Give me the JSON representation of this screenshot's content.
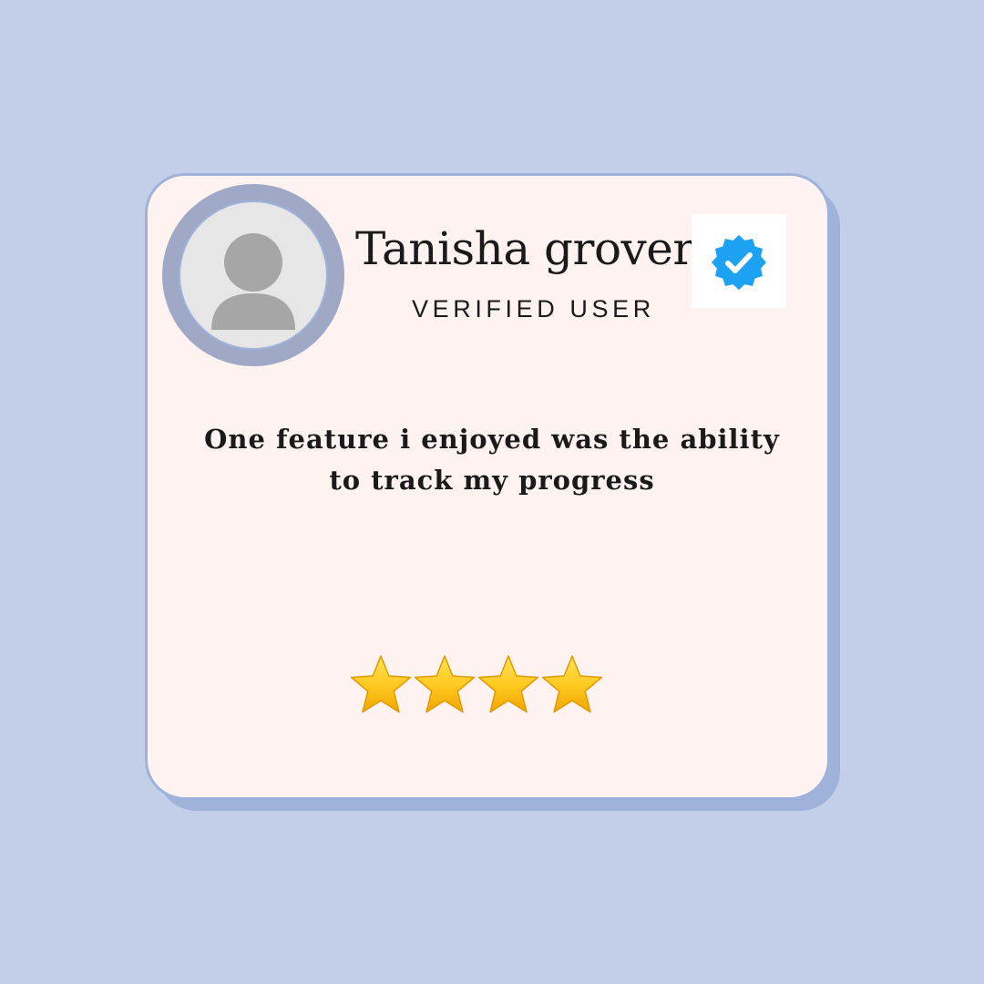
{
  "reviewer": {
    "name": "Tanisha grover",
    "status": "VERIFIED USER",
    "badge_icon": "verified-badge-icon",
    "avatar_icon": "user-silhouette-icon"
  },
  "review": {
    "line1": "One feature i enjoyed was the ability",
    "line2": "to track my progress"
  },
  "rating": {
    "stars": 4,
    "max": 4
  },
  "colors": {
    "background": "#c3cfe8",
    "card": "#fff3f2",
    "card_border": "#9fb2da",
    "card_shadow": "#9fb2da",
    "avatar_ring": "#9fa9c6",
    "avatar_fill": "#e6e6e6",
    "avatar_figure": "#a6a6a6",
    "badge_blue": "#1da1f2",
    "text": "#1a1a1a",
    "star": "#ffc81e"
  }
}
